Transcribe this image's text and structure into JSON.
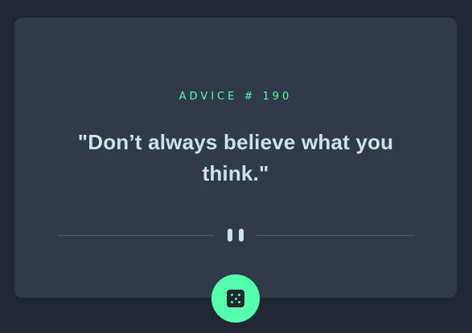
{
  "advice": {
    "id_label": "ADVICE # 190",
    "quote": "\"Don’t always believe what you think.\""
  },
  "colors": {
    "page_background": "#202733",
    "card_background": "#313a48",
    "accent": "#53ffab",
    "text": "#cee3e9",
    "divider": "#4f5d74"
  },
  "icons": {
    "divider_icon": "pause-icon",
    "button_icon": "dice-icon"
  }
}
